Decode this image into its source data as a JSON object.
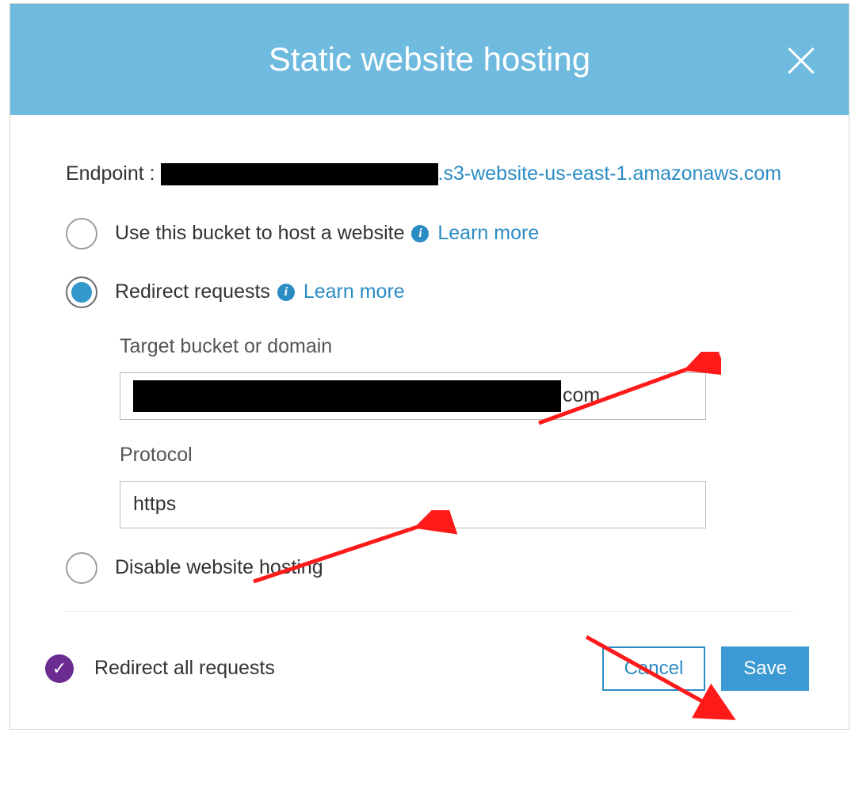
{
  "header": {
    "title": "Static website hosting"
  },
  "endpoint": {
    "label": "Endpoint : ",
    "link_suffix": ".s3-website-us-east-1.amazonaws.com"
  },
  "options": {
    "host": {
      "label": "Use this bucket to host a website",
      "learn_more": "Learn more"
    },
    "redirect": {
      "label": "Redirect requests",
      "learn_more": "Learn more",
      "target_field_label": "Target bucket or domain",
      "target_value_suffix": "com",
      "protocol_field_label": "Protocol",
      "protocol_value": "https"
    },
    "disable": {
      "label": "Disable website hosting"
    }
  },
  "footer": {
    "status": "Redirect all requests",
    "cancel": "Cancel",
    "save": "Save"
  }
}
